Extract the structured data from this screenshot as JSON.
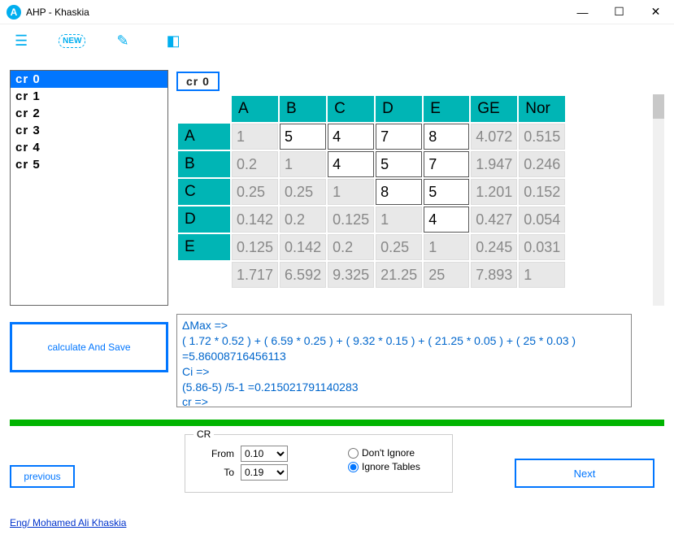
{
  "window": {
    "title": "AHP - Khaskia"
  },
  "toolbar": {
    "menu": "☰",
    "new": "NEW",
    "edit": "✎",
    "view": "◧"
  },
  "cr_list": {
    "items": [
      {
        "label": "cr 0",
        "selected": true
      },
      {
        "label": "cr 1",
        "selected": false
      },
      {
        "label": "cr 2",
        "selected": false
      },
      {
        "label": "cr 3",
        "selected": false
      },
      {
        "label": "cr 4",
        "selected": false
      },
      {
        "label": "cr 5",
        "selected": false
      }
    ]
  },
  "current_tag": "cr 0",
  "matrix": {
    "col_headers": [
      "A",
      "B",
      "C",
      "D",
      "E",
      "GE",
      "Nor"
    ],
    "row_headers": [
      "A",
      "B",
      "C",
      "D",
      "E"
    ],
    "rows": [
      {
        "cells": [
          "1",
          "5",
          "4",
          "7",
          "8"
        ],
        "editable": [
          false,
          true,
          true,
          true,
          true
        ],
        "ge": "4.072",
        "nor": "0.515"
      },
      {
        "cells": [
          "0.2",
          "1",
          "4",
          "5",
          "7"
        ],
        "editable": [
          false,
          false,
          true,
          true,
          true
        ],
        "ge": "1.947",
        "nor": "0.246"
      },
      {
        "cells": [
          "0.25",
          "0.25",
          "1",
          "8",
          "5"
        ],
        "editable": [
          false,
          false,
          false,
          true,
          true
        ],
        "ge": "1.201",
        "nor": "0.152"
      },
      {
        "cells": [
          "0.142",
          "0.2",
          "0.125",
          "1",
          "4"
        ],
        "editable": [
          false,
          false,
          false,
          false,
          true
        ],
        "ge": "0.427",
        "nor": "0.054"
      },
      {
        "cells": [
          "0.125",
          "0.142",
          "0.2",
          "0.25",
          "1"
        ],
        "editable": [
          false,
          false,
          false,
          false,
          false
        ],
        "ge": "0.245",
        "nor": "0.031"
      }
    ],
    "sums": [
      "1.717",
      "6.592",
      "9.325",
      "21.25",
      "25",
      "7.893",
      "1"
    ]
  },
  "calc_button": "calculate And Save",
  "output": {
    "l1": "ΔMax =>",
    "l2": "( 1.72 * 0.52 )  + ( 6.59 * 0.25 )  + ( 9.32 * 0.15 )  + ( 21.25 * 0.05 )  + ( 25 * 0.03 )  =5.86008716456113",
    "l3": "Ci =>",
    "l4": "(5.86-5) /5-1 =0.215021791140283",
    "l5": "cr =>"
  },
  "cr_settings": {
    "legend": "CR",
    "from_label": "From",
    "from_value": "0.10",
    "to_label": "To",
    "to_value": "0.19",
    "radio1": "Don't Ignore",
    "radio2": "Ignore Tables",
    "selected": "ignore"
  },
  "nav": {
    "prev": "previous",
    "next": "Next"
  },
  "footer": "Eng/ Mohamed Ali Khaskia"
}
